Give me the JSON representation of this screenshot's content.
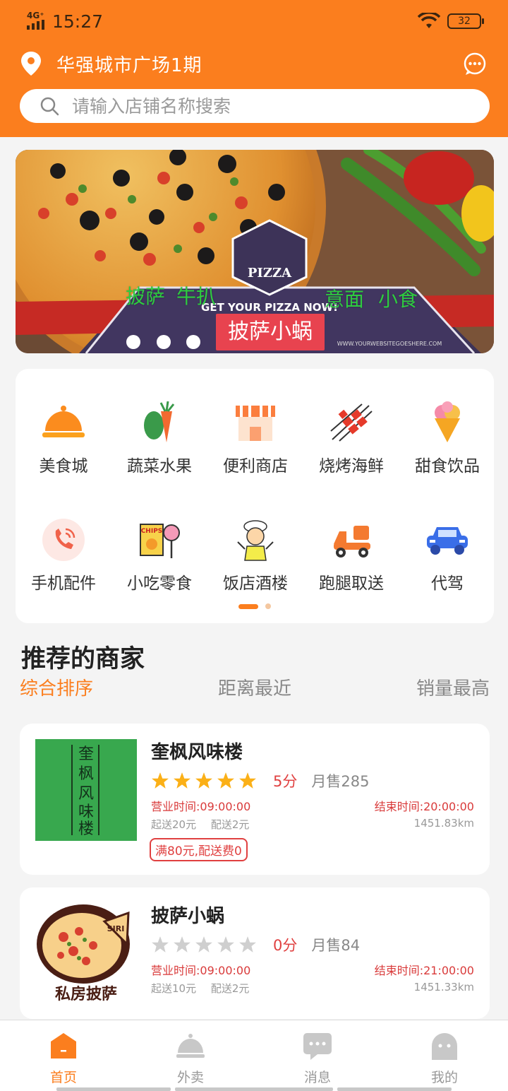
{
  "status_bar": {
    "network": "4G⁺",
    "time": "15:27",
    "battery": "32"
  },
  "header": {
    "location": "华强城市广场1期",
    "search_placeholder": "请输入店铺名称搜索"
  },
  "banner": {
    "tags": [
      "披萨",
      "牛扒",
      "意面",
      "小食"
    ],
    "shop_label": "披萨小蜗",
    "logo_text": "PIZZA",
    "slogan": "GET YOUR PIZZA NOW!",
    "website": "WWW.YOURWEBSITEGOESHERE.COM"
  },
  "categories": [
    {
      "label": "美食城",
      "icon": "food-cover-icon"
    },
    {
      "label": "蔬菜水果",
      "icon": "vegetable-icon"
    },
    {
      "label": "便利商店",
      "icon": "store-icon"
    },
    {
      "label": "烧烤海鲜",
      "icon": "bbq-icon"
    },
    {
      "label": "甜食饮品",
      "icon": "ice-cream-icon"
    },
    {
      "label": "手机配件",
      "icon": "phone-icon"
    },
    {
      "label": "小吃零食",
      "icon": "snack-icon"
    },
    {
      "label": "饭店酒楼",
      "icon": "chef-icon"
    },
    {
      "label": "跑腿取送",
      "icon": "delivery-scooter-icon"
    },
    {
      "label": "代驾",
      "icon": "car-icon"
    }
  ],
  "section": {
    "title": "推荐的商家",
    "sort_tabs": [
      "综合排序",
      "距离最近",
      "销量最高"
    ]
  },
  "merchants": [
    {
      "name": "奎枫风味楼",
      "rating": 5,
      "score": "5分",
      "monthly_sales": "月售285",
      "open_time": "营业时间:09:00:00",
      "close_time": "结束时间:20:00:00",
      "min_order": "起送20元",
      "delivery_fee": "配送2元",
      "distance": "1451.83km",
      "promo": "满80元,配送费0",
      "logo_text": "奎枫风味楼"
    },
    {
      "name": "披萨小蜗",
      "rating": 0,
      "score": "0分",
      "monthly_sales": "月售84",
      "open_time": "营业时间:09:00:00",
      "close_time": "结束时间:21:00:00",
      "min_order": "起送10元",
      "delivery_fee": "配送2元",
      "distance": "1451.33km",
      "logo_text": "私房披萨",
      "logo_badge": "SIRI"
    }
  ],
  "tabbar": [
    {
      "label": "首页",
      "icon": "home-icon",
      "active": true
    },
    {
      "label": "外卖",
      "icon": "takeout-icon",
      "active": false
    },
    {
      "label": "消息",
      "icon": "message-icon",
      "active": false
    },
    {
      "label": "我的",
      "icon": "profile-icon",
      "active": false
    }
  ],
  "colors": {
    "brand": "#fb7e1e",
    "price_red": "#e04040",
    "star_gold": "#fbb017"
  }
}
